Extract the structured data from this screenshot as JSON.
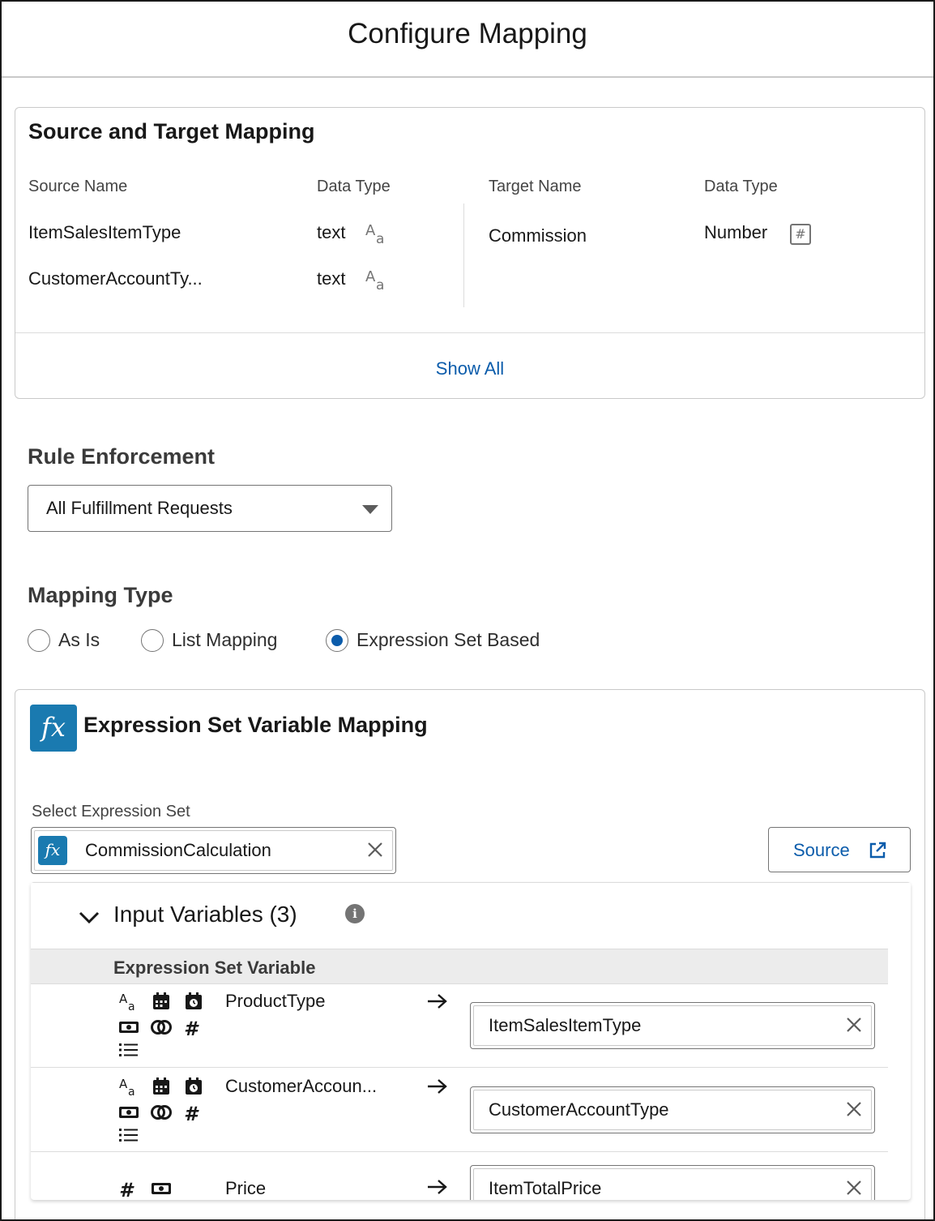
{
  "modal": {
    "title": "Configure Mapping"
  },
  "source_target": {
    "title": "Source and Target Mapping",
    "headers": {
      "source_name": "Source Name",
      "source_type": "Data Type",
      "target_name": "Target Name",
      "target_type": "Data Type"
    },
    "sources": [
      {
        "name": "ItemSalesItemType",
        "type": "text",
        "type_icon": "text-type-icon"
      },
      {
        "name": "CustomerAccountTy...",
        "type": "text",
        "type_icon": "text-type-icon"
      }
    ],
    "target": {
      "name": "Commission",
      "type": "Number",
      "type_icon": "number-type-icon"
    },
    "show_all": "Show All"
  },
  "rule_enforcement": {
    "title": "Rule Enforcement",
    "selected": "All Fulfillment Requests"
  },
  "mapping_type": {
    "title": "Mapping Type",
    "options": [
      {
        "label": "As Is",
        "checked": false
      },
      {
        "label": "List Mapping",
        "checked": false
      },
      {
        "label": "Expression Set Based",
        "checked": true
      }
    ]
  },
  "expression_mapping": {
    "badge": "fx",
    "title": "Expression Set Variable Mapping",
    "select_label": "Select Expression Set",
    "selected_set": "CommissionCalculation",
    "source_button": "Source",
    "input_variables": {
      "title": "Input Variables (3)",
      "column_header": "Expression Set Variable",
      "rows": [
        {
          "variable": "ProductType",
          "value": "ItemSalesItemType"
        },
        {
          "variable": "CustomerAccoun...",
          "value": "CustomerAccountType"
        },
        {
          "variable": "Price",
          "value": "ItemTotalPrice"
        }
      ]
    }
  },
  "colors": {
    "accent": "#0b5cab",
    "fx_badge": "#1a7ab0",
    "border": "#747474",
    "header_bg": "#ececec"
  }
}
